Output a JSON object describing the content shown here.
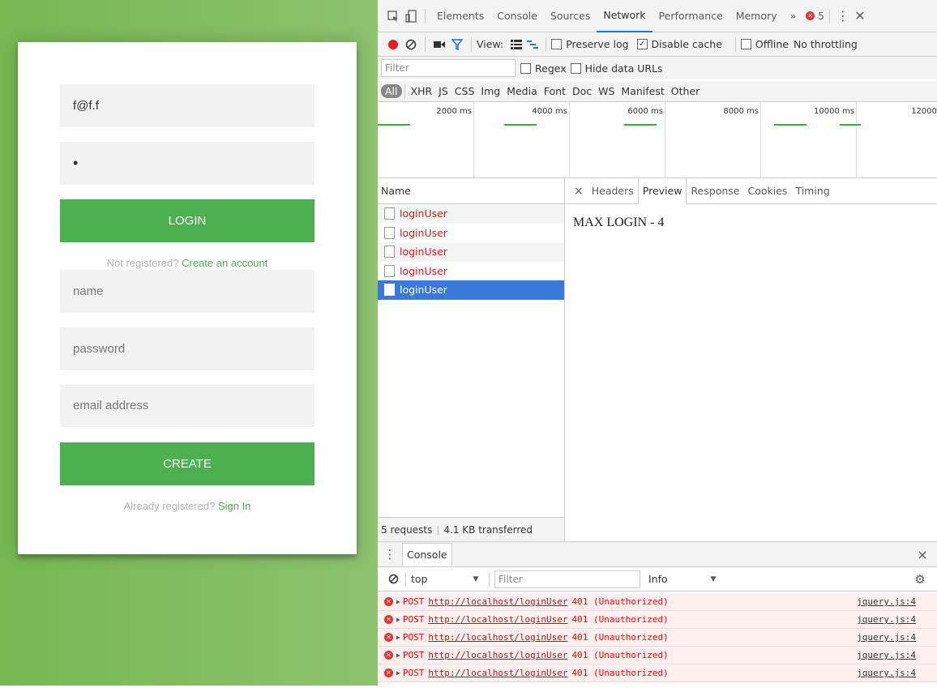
{
  "login": {
    "email_value": "f@f.f",
    "password_value": "•",
    "login_button": "LOGIN",
    "not_registered_text": "Not registered?",
    "create_account_link": "Create an account"
  },
  "register": {
    "name_placeholder": "name",
    "password_placeholder": "password",
    "email_placeholder": "email address",
    "create_button": "CREATE",
    "already_registered_text": "Already registered?",
    "sign_in_link": "Sign In"
  },
  "devtools": {
    "tabs": [
      "Elements",
      "Console",
      "Sources",
      "Network",
      "Performance",
      "Memory"
    ],
    "active_tab": "Network",
    "more_tabs": "»",
    "error_count": "5",
    "toolbar": {
      "view_label": "View:",
      "preserve_log": "Preserve log",
      "disable_cache": "Disable cache",
      "offline": "Offline",
      "throttling": "No throttling"
    },
    "filter": {
      "placeholder": "Filter",
      "regex": "Regex",
      "hide_data_urls": "Hide data URLs"
    },
    "types": [
      "All",
      "XHR",
      "JS",
      "CSS",
      "Img",
      "Media",
      "Font",
      "Doc",
      "WS",
      "Manifest",
      "Other"
    ],
    "timeline_ticks": [
      "2000 ms",
      "4000 ms",
      "6000 ms",
      "8000 ms",
      "10000 ms",
      "12000"
    ],
    "requests": {
      "header": "Name",
      "items": [
        "loginUser",
        "loginUser",
        "loginUser",
        "loginUser",
        "loginUser"
      ],
      "status": "5 requests",
      "transferred": "4.1 KB transferred"
    },
    "detail": {
      "close": "×",
      "tabs": [
        "Headers",
        "Preview",
        "Response",
        "Cookies",
        "Timing"
      ],
      "active_tab": "Preview",
      "preview_text": "MAX LOGIN - 4"
    },
    "drawer": {
      "tab": "Console",
      "close": "×",
      "context": "top",
      "filter_placeholder": "Filter",
      "level": "Info",
      "errors": [
        {
          "method": "POST",
          "url": "http://localhost/loginUser",
          "status": "401 (Unauthorized)",
          "source": "jquery.js:4"
        },
        {
          "method": "POST",
          "url": "http://localhost/loginUser",
          "status": "401 (Unauthorized)",
          "source": "jquery.js:4"
        },
        {
          "method": "POST",
          "url": "http://localhost/loginUser",
          "status": "401 (Unauthorized)",
          "source": "jquery.js:4"
        },
        {
          "method": "POST",
          "url": "http://localhost/loginUser",
          "status": "401 (Unauthorized)",
          "source": "jquery.js:4"
        },
        {
          "method": "POST",
          "url": "http://localhost/loginUser",
          "status": "401 (Unauthorized)",
          "source": "jquery.js:4"
        }
      ]
    }
  },
  "colors": {
    "accent_green": "#4CAF50",
    "bg_green": "#76b852",
    "error_red": "#ff0000",
    "selection_blue": "#3879d9"
  }
}
